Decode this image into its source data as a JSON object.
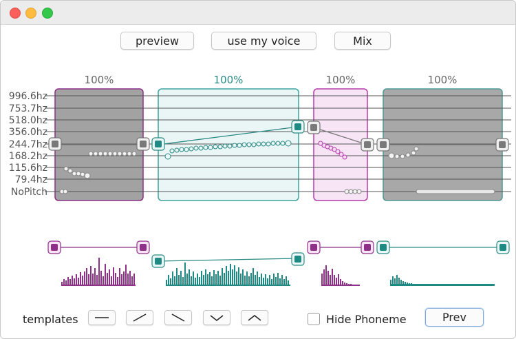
{
  "toolbar": {
    "preview": "preview",
    "use_my_voice": "use my voice",
    "mix": "Mix"
  },
  "pitch_labels": [
    "996.6hz",
    "753.7hz",
    "518.0hz",
    "356.0hz",
    "244.7hz",
    "168.2hz",
    "115.6hz",
    "79.4hz",
    "NoPitch"
  ],
  "segments": [
    {
      "percent": "100%",
      "color": "#8e3f8a",
      "state": "grey"
    },
    {
      "percent": "100%",
      "color": "#2a8a84",
      "state": "teal"
    },
    {
      "percent": "100%",
      "color": "#b43aa8",
      "state": "pink"
    },
    {
      "percent": "100%",
      "color": "#6f6f6f",
      "state": "grey"
    }
  ],
  "bottom": {
    "templates_label": "templates",
    "template_icons": [
      "flat-line-icon",
      "rising-line-icon",
      "falling-line-icon",
      "valley-icon",
      "peak-icon"
    ],
    "hide_phoneme_label": "Hide Phoneme",
    "hide_phoneme_checked": false,
    "prev_label": "Prev"
  },
  "colors": {
    "purple": "#8e2f88",
    "teal": "#1f8a84",
    "pink": "#c23bb5"
  }
}
